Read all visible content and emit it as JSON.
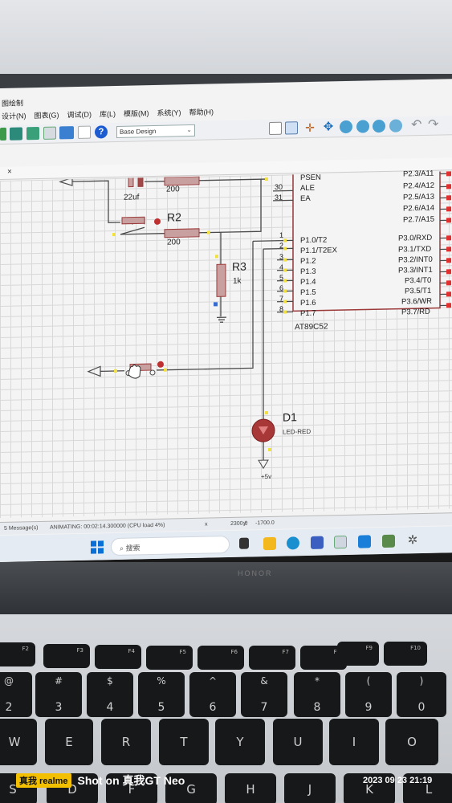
{
  "app": {
    "title": "图绘制",
    "menu": [
      "设计(N)",
      "图表(G)",
      "调试(D)",
      "库(L)",
      "模版(M)",
      "系统(Y)",
      "帮助(H)"
    ],
    "design_select": "Base Design",
    "tab_close": "×"
  },
  "schematic": {
    "capacitor_value": "22uf",
    "resistor_top_value": "200",
    "r2_ref": "R2",
    "r2_value": "200",
    "r3_ref": "R3",
    "r3_value": "1k",
    "d1_ref": "D1",
    "d1_value": "LED-RED",
    "supply_label": "+5v",
    "chip_name": "AT89C52",
    "left_pins_top": [
      {
        "num": "30",
        "name": "ALE"
      },
      {
        "num": "31",
        "name": "EA"
      }
    ],
    "left_pin_psen": "PSEN",
    "left_pins": [
      {
        "num": "1",
        "name": "P1.0/T2"
      },
      {
        "num": "2",
        "name": "P1.1/T2EX"
      },
      {
        "num": "3",
        "name": "P1.2"
      },
      {
        "num": "4",
        "name": "P1.3"
      },
      {
        "num": "5",
        "name": "P1.4"
      },
      {
        "num": "6",
        "name": "P1.5"
      },
      {
        "num": "7",
        "name": "P1.6"
      },
      {
        "num": "8",
        "name": "P1.7"
      }
    ],
    "right_pins_top": [
      "P2.3/A11",
      "P2.4/A12",
      "P2.5/A13",
      "P2.6/A14",
      "P2.7/A15"
    ],
    "right_pins": [
      "P3.0/RXD",
      "P3.1/TXD",
      "P3.2/INT0",
      "P3.3/INT1",
      "P3.4/T0",
      "P3.5/T1",
      "P3.6/WR",
      "P3.7/RD"
    ]
  },
  "status": {
    "messages": "5 Message(s)",
    "animating": "ANIMATING: 00:02:14.300000 (CPU load 4%)",
    "x_label": "x",
    "x_value": "2300.0",
    "y_label": "y:",
    "y_value": "-1700.0"
  },
  "taskbar": {
    "search_placeholder": "搜索"
  },
  "laptop": {
    "brand": "HONOR"
  },
  "keyboard": {
    "fn_row": [
      "F2",
      "F3",
      "F4",
      "F5",
      "F6",
      "F7",
      "F8",
      "F9",
      "F10"
    ],
    "num_row_top": [
      "@",
      "#",
      "$",
      "%",
      "^",
      "&",
      "*",
      "(",
      ")"
    ],
    "num_row": [
      "2",
      "3",
      "4",
      "5",
      "6",
      "7",
      "8",
      "9",
      "0"
    ],
    "letter_row": [
      "W",
      "E",
      "R",
      "T",
      "Y",
      "U",
      "I",
      "O"
    ],
    "bottom_row": [
      "S",
      "D",
      "F",
      "G",
      "H",
      "J",
      "K",
      "L"
    ]
  },
  "watermark": {
    "badge": "真我 realme",
    "text": "Shot on 真我GT Neo",
    "datetime": "2023 09 23 21:19"
  },
  "colors": {
    "wire": "#4a4a4a",
    "component_body": "#a04848",
    "chip_outline": "#9c3a3a",
    "pin_marker": "#f0e040",
    "led": "#c04040",
    "taskbar_accent": "#0a6fd6"
  }
}
